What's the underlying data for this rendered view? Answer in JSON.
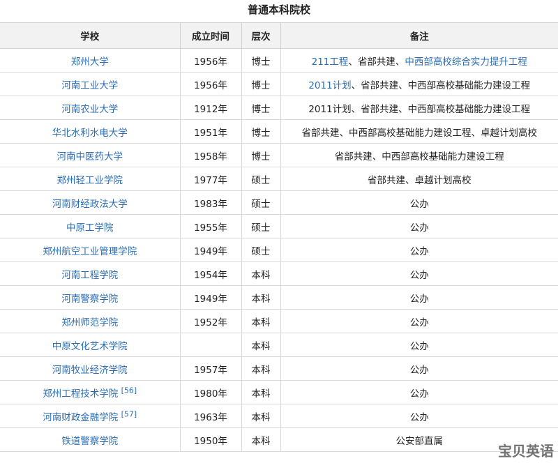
{
  "caption": "普通本科院校",
  "headers": [
    "学校",
    "成立时间",
    "层次",
    "备注"
  ],
  "rows": [
    {
      "school": "郑州大学",
      "year": "1956年",
      "level": "博士",
      "notes": [
        {
          "text": "211工程",
          "link": true
        },
        {
          "text": "、省部共建、",
          "link": false
        },
        {
          "text": "中西部高校综合实力提升工程",
          "link": true
        }
      ]
    },
    {
      "school": "河南工业大学",
      "year": "1956年",
      "level": "博士",
      "notes": [
        {
          "text": "2011计划",
          "link": true
        },
        {
          "text": "、省部共建、中西部高校基础能力建设工程",
          "link": false
        }
      ]
    },
    {
      "school": "河南农业大学",
      "year": "1912年",
      "level": "博士",
      "notes": [
        {
          "text": "2011计划、省部共建、中西部高校基础能力建设工程",
          "link": false
        }
      ]
    },
    {
      "school": "华北水利水电大学",
      "year": "1951年",
      "level": "博士",
      "notes": [
        {
          "text": "省部共建、中西部高校基础能力建设工程、卓越计划高校",
          "link": false
        }
      ]
    },
    {
      "school": "河南中医药大学",
      "year": "1958年",
      "level": "博士",
      "notes": [
        {
          "text": "省部共建、中西部高校基础能力建设工程",
          "link": false
        }
      ]
    },
    {
      "school": "郑州轻工业学院",
      "year": "1977年",
      "level": "硕士",
      "notes": [
        {
          "text": "省部共建、卓越计划高校",
          "link": false
        }
      ]
    },
    {
      "school": "河南财经政法大学",
      "year": "1983年",
      "level": "硕士",
      "notes": [
        {
          "text": "公办",
          "link": false
        }
      ]
    },
    {
      "school": "中原工学院",
      "year": "1955年",
      "level": "硕士",
      "notes": [
        {
          "text": "公办",
          "link": false
        }
      ]
    },
    {
      "school": "郑州航空工业管理学院",
      "year": "1949年",
      "level": "硕士",
      "notes": [
        {
          "text": "公办",
          "link": false
        }
      ]
    },
    {
      "school": "河南工程学院",
      "year": "1954年",
      "level": "本科",
      "notes": [
        {
          "text": "公办",
          "link": false
        }
      ]
    },
    {
      "school": "河南警察学院",
      "year": "1949年",
      "level": "本科",
      "notes": [
        {
          "text": "公办",
          "link": false
        }
      ]
    },
    {
      "school": "郑州师范学院",
      "year": "1952年",
      "level": "本科",
      "notes": [
        {
          "text": "公办",
          "link": false
        }
      ]
    },
    {
      "school": "中原文化艺术学院",
      "year": "",
      "level": "本科",
      "notes": [
        {
          "text": "公办",
          "link": false
        }
      ]
    },
    {
      "school": "河南牧业经济学院",
      "year": "1957年",
      "level": "本科",
      "notes": [
        {
          "text": "公办",
          "link": false
        }
      ]
    },
    {
      "school": "郑州工程技术学院",
      "ref": "[56]",
      "year": "1980年",
      "level": "本科",
      "notes": [
        {
          "text": "公办",
          "link": false
        }
      ]
    },
    {
      "school": "河南财政金融学院",
      "ref": "[57]",
      "year": "1963年",
      "level": "本科",
      "notes": [
        {
          "text": "公办",
          "link": false
        }
      ]
    },
    {
      "school": "铁道警察学院",
      "year": "1950年",
      "level": "本科",
      "notes": [
        {
          "text": "公安部直属",
          "link": false
        }
      ]
    }
  ],
  "watermark": "宝贝英语",
  "colors": {
    "link": "#2a6db4",
    "header_bg": "#f2f2f2",
    "border": "#d8d8d8"
  }
}
